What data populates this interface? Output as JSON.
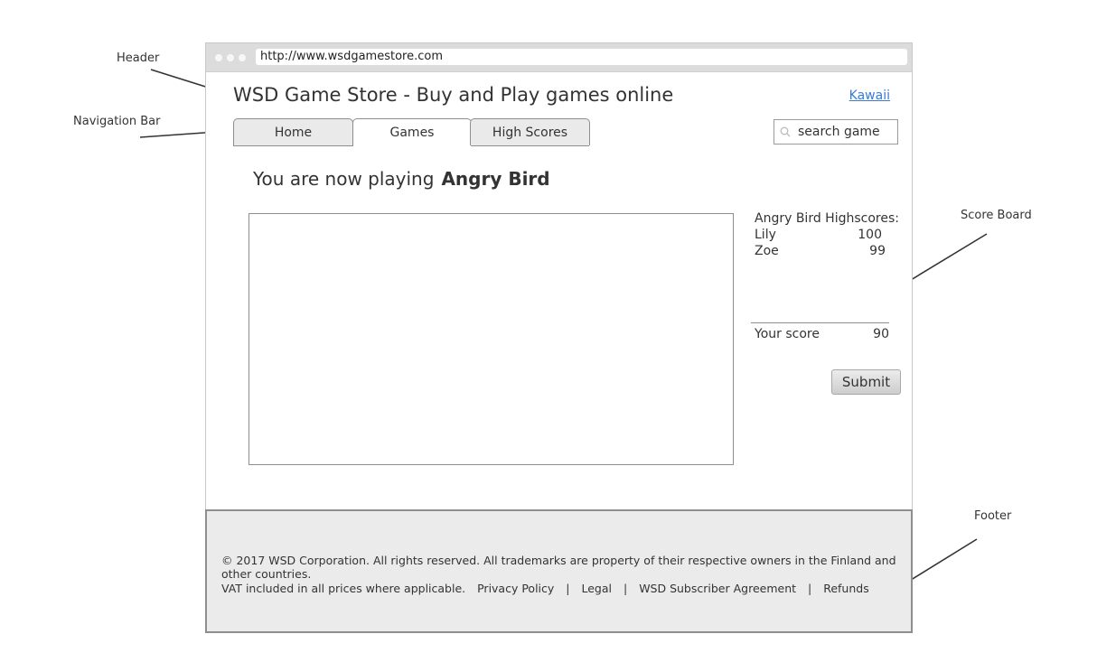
{
  "annotations": {
    "header": "Header",
    "navigation_bar": "Navigation Bar",
    "score_board": "Score Board",
    "footer": "Footer"
  },
  "browser": {
    "url": "http://www.wsdgamestore.com"
  },
  "header": {
    "title": "WSD Game Store - Buy and Play games online",
    "user_link": "Kawaii"
  },
  "nav": {
    "tabs": [
      {
        "label": "Home",
        "active": false
      },
      {
        "label": "Games",
        "active": true
      },
      {
        "label": "High Scores",
        "active": false
      }
    ],
    "search": {
      "value": "search game",
      "icon": "search-icon"
    }
  },
  "main": {
    "now_playing_prefix": "You are now playing",
    "game_name": "Angry Bird"
  },
  "score_board": {
    "title": "Angry Bird Highscores:",
    "entries": [
      {
        "name": "Lily",
        "score": "100"
      },
      {
        "name": "Zoe",
        "score": "99"
      }
    ],
    "your_score_label": "Your score",
    "your_score": "90",
    "submit_label": "Submit"
  },
  "footer": {
    "copyright": "© 2017 WSD Corporation. All rights reserved. All trademarks are property of their respective owners in the Finland and other countries.",
    "vat": "VAT included in all prices where applicable.",
    "links": [
      "Privacy Policy",
      "Legal",
      "WSD Subscriber Agreement",
      "Refunds"
    ],
    "separator": "|"
  }
}
